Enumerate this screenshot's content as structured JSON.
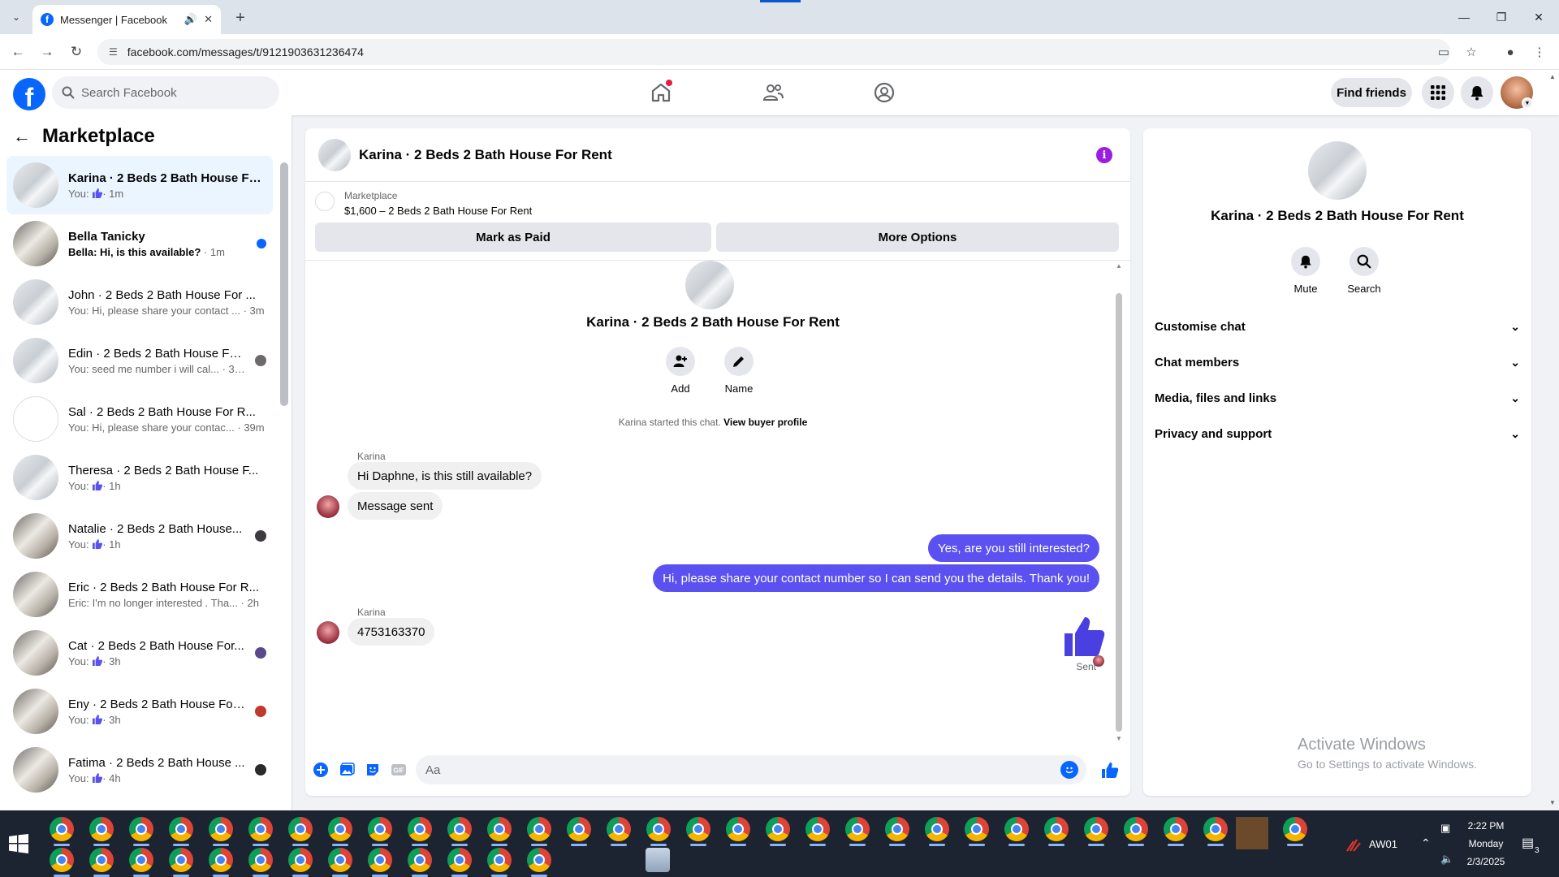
{
  "browser": {
    "tab_title": "Messenger | Facebook",
    "url": "facebook.com/messages/t/9121903631236474",
    "new_tab": "+"
  },
  "fb": {
    "logo": "f",
    "search_placeholder": "Search Facebook",
    "find_friends": "Find friends"
  },
  "sidebar": {
    "title": "Marketplace",
    "chats": [
      {
        "name": "Karina · 2 Beds 2 Bath House Fo...",
        "preview": "You:",
        "time": "· 1m",
        "like": true,
        "active": true,
        "unread": false
      },
      {
        "name": "Bella Tanicky",
        "preview": "Bella: Hi, is this available?",
        "time": "· 1m",
        "like": false,
        "active": false,
        "unread": true
      },
      {
        "name": "John · 2 Beds 2 Bath House For ...",
        "preview": "You: Hi, please share your contact ...",
        "time": "· 3m",
        "like": false
      },
      {
        "name": "Edin · 2 Beds 2 Bath House Fo...",
        "preview": "You: seed me number i will cal...",
        "time": "· 37m",
        "like": false
      },
      {
        "name": "Sal · 2 Beds 2 Bath House For R...",
        "preview": "You: Hi, please share your contac...",
        "time": "· 39m",
        "like": false
      },
      {
        "name": "Theresa · 2 Beds 2 Bath House F...",
        "preview": "You:",
        "time": "· 1h",
        "like": true
      },
      {
        "name": "Natalie · 2 Beds 2 Bath House...",
        "preview": "You:",
        "time": "· 1h",
        "like": true
      },
      {
        "name": "Eric · 2 Beds 2 Bath House For R...",
        "preview": "Eric: I'm no longer interested . Tha...",
        "time": "· 2h",
        "like": false
      },
      {
        "name": "Cat · 2 Beds 2 Bath House For...",
        "preview": "You:",
        "time": "· 3h",
        "like": true
      },
      {
        "name": "Eny · 2 Beds 2 Bath House For...",
        "preview": "You:",
        "time": "· 3h",
        "like": true
      },
      {
        "name": "Fatima · 2 Beds 2 Bath House ...",
        "preview": "You:",
        "time": "· 4h",
        "like": true
      }
    ]
  },
  "conversation": {
    "title": "Karina · 2 Beds 2 Bath House For Rent",
    "marketplace_label": "Marketplace",
    "listing": "$1,600 – 2 Beds 2 Bath House For Rent",
    "mark_paid": "Mark as Paid",
    "more_options": "More Options",
    "add_label": "Add",
    "name_label": "Name",
    "started_text": "Karina started this chat.",
    "view_profile": "View buyer profile",
    "sender_name": "Karina",
    "messages": {
      "in1": "Hi Daphne, is this still available?",
      "in2": "Message sent",
      "out1": "Yes, are you still interested?",
      "out2": "Hi, please share your contact number so I can send you the details. Thank you!",
      "in3": "4753163370"
    },
    "sent_label": "Sent",
    "composer_placeholder": "Aa"
  },
  "info_panel": {
    "name": "Karina · 2 Beds 2 Bath House For Rent",
    "mute": "Mute",
    "search": "Search",
    "sections": [
      "Customise chat",
      "Chat members",
      "Media, files and links",
      "Privacy and support"
    ]
  },
  "watermark": {
    "line1": "Activate Windows",
    "line2": "Go to Settings to activate Windows."
  },
  "taskbar": {
    "aw_label": "AW01",
    "time": "2:22 PM",
    "day": "Monday",
    "date": "2/3/2025",
    "notif_count": "3"
  },
  "colors": {
    "fb_blue": "#0866ff",
    "bubble_out": "#5b50f0",
    "info_purple": "#9b1de0"
  }
}
